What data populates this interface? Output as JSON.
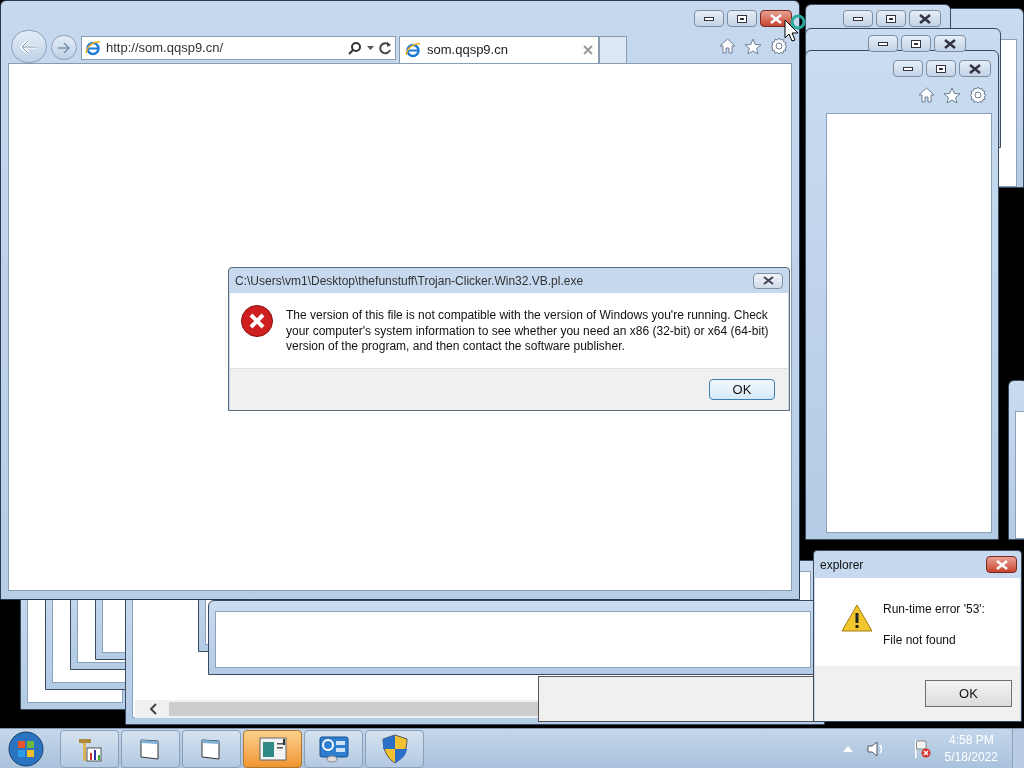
{
  "browser": {
    "address": "http://som.qqsp9.cn/",
    "tab_title": "som.qqsp9.cn"
  },
  "error_dialog": {
    "title": "C:\\Users\\vm1\\Desktop\\thefunstuff\\Trojan-Clicker.Win32.VB.pl.exe",
    "message": "The version of this file is not compatible with the version of Windows you're running. Check your computer's system information to see whether you need an x86 (32-bit) or x64 (64-bit) version of the program, and then contact the software publisher.",
    "button": "OK"
  },
  "runtime_dialog": {
    "title": "explorer",
    "lines": [
      "Run-time error '53':",
      "File not found"
    ],
    "button": "OK"
  },
  "taskbar": {
    "items": [
      {
        "kind": "tools",
        "selected": false
      },
      {
        "kind": "window",
        "selected": false
      },
      {
        "kind": "window",
        "selected": false
      },
      {
        "kind": "viewer",
        "selected": true
      },
      {
        "kind": "control-panel",
        "selected": false
      },
      {
        "kind": "shield",
        "selected": false
      }
    ],
    "time": "4:58 PM",
    "date": "5/18/2022"
  }
}
